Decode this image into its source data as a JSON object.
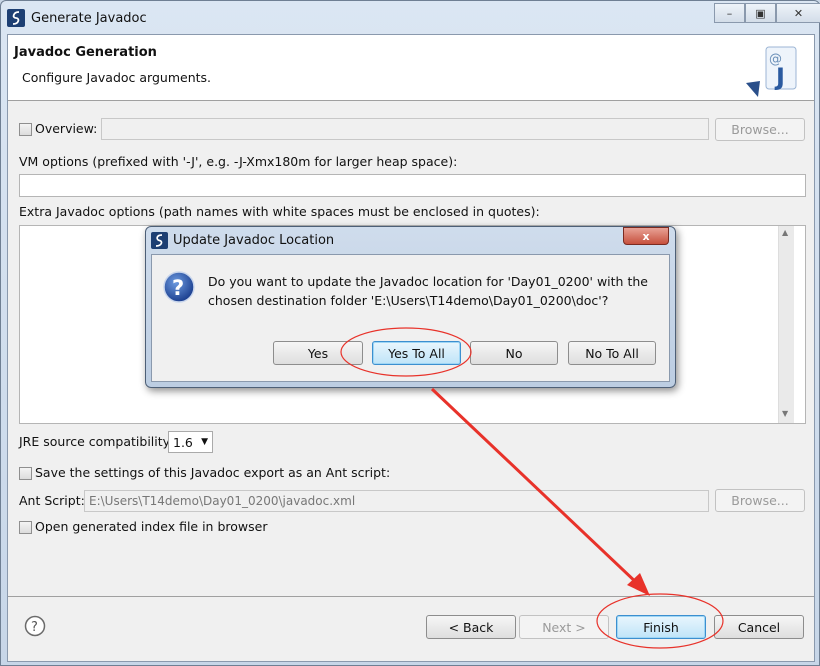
{
  "window": {
    "title": "Generate Javadoc",
    "minimize": "minimize",
    "maximize": "maximize",
    "close": "close"
  },
  "header": {
    "title": "Javadoc Generation",
    "subtitle": "Configure Javadoc arguments."
  },
  "form": {
    "overview_label": "Overview:",
    "overview_checked": false,
    "overview_value": "",
    "browse_label": "Browse...",
    "vm_label": "VM options (prefixed with '-J', e.g. -J-Xmx180m for larger heap space):",
    "vm_value": "",
    "extra_label": "Extra Javadoc options (path names with white spaces must be enclosed in quotes):",
    "extra_value": "",
    "jre_label": "JRE source compatibility:",
    "jre_value": "1.6",
    "save_ant_label": "Save the settings of this Javadoc export as an Ant script:",
    "save_ant_checked": false,
    "ant_label": "Ant Script:",
    "ant_value": "E:\\Users\\T14demo\\Day01_0200\\javadoc.xml",
    "ant_browse_label": "Browse...",
    "open_index_label": "Open generated index file in browser",
    "open_index_checked": false
  },
  "footer": {
    "back": "< Back",
    "next": "Next >",
    "finish": "Finish",
    "cancel": "Cancel"
  },
  "dialog": {
    "title": "Update Javadoc Location",
    "close": "x",
    "message_line1": "Do you want to update the Javadoc location for 'Day01_0200' with the",
    "message_line2": "chosen destination folder 'E:\\Users\\T14demo\\Day01_0200\\doc'?",
    "buttons": [
      "Yes",
      "Yes To All",
      "No",
      "No To All"
    ]
  },
  "annotation_color": "#e8322a"
}
